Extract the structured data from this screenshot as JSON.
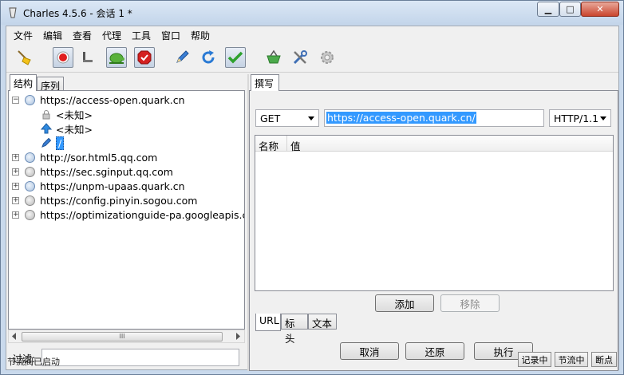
{
  "window": {
    "title": "Charles 4.5.6 - 会话 1 *",
    "minimize_glyph": "▁",
    "maximize_glyph": "□",
    "close_glyph": "✕"
  },
  "menu": [
    "文件",
    "编辑",
    "查看",
    "代理",
    "工具",
    "窗口",
    "帮助"
  ],
  "toolbar": {
    "icons": [
      "broom-icon",
      "record-icon",
      "throttle-icon",
      "breakpoint-icon",
      "block-icon",
      "pen-icon",
      "refresh-icon",
      "check-icon",
      "basket-icon",
      "tools-icon",
      "gear-icon"
    ]
  },
  "left": {
    "tabs": [
      "结构",
      "序列"
    ],
    "tree": [
      {
        "label": "https://access-open.quark.cn",
        "expanded": true,
        "icon": "globe-icon"
      },
      {
        "label": "<未知>",
        "icon": "lock-icon"
      },
      {
        "label": "<未知>",
        "icon": "upload-arrow-icon"
      },
      {
        "label": "/",
        "icon": "pen-icon",
        "selected": true
      },
      {
        "label": "http://sor.html5.qq.com",
        "icon": "globe-icon"
      },
      {
        "label": "https://sec.sginput.qq.com",
        "icon": "locked-globe-icon"
      },
      {
        "label": "https://unpm-upaas.quark.cn",
        "icon": "globe-icon"
      },
      {
        "label": "https://config.pinyin.sogou.com",
        "icon": "locked-globe-icon"
      },
      {
        "label": "https://optimizationguide-pa.googleapis.com",
        "icon": "locked-globe-icon"
      }
    ],
    "scroll_grip": "III",
    "filter_label": "过滤:",
    "filter_value": ""
  },
  "right": {
    "tab": "撰写",
    "method": "GET",
    "url": "https://access-open.quark.cn/",
    "protocol": "HTTP/1.1",
    "columns": [
      "名称",
      "值"
    ],
    "add_button": "添加",
    "remove_button": "移除",
    "subtabs": [
      "URL",
      "标头",
      "文本"
    ],
    "cancel_button": "取消",
    "revert_button": "还原",
    "execute_button": "执行"
  },
  "status": {
    "text": "节流阀已启动",
    "buttons": [
      "记录中",
      "节流中",
      "断点"
    ]
  }
}
